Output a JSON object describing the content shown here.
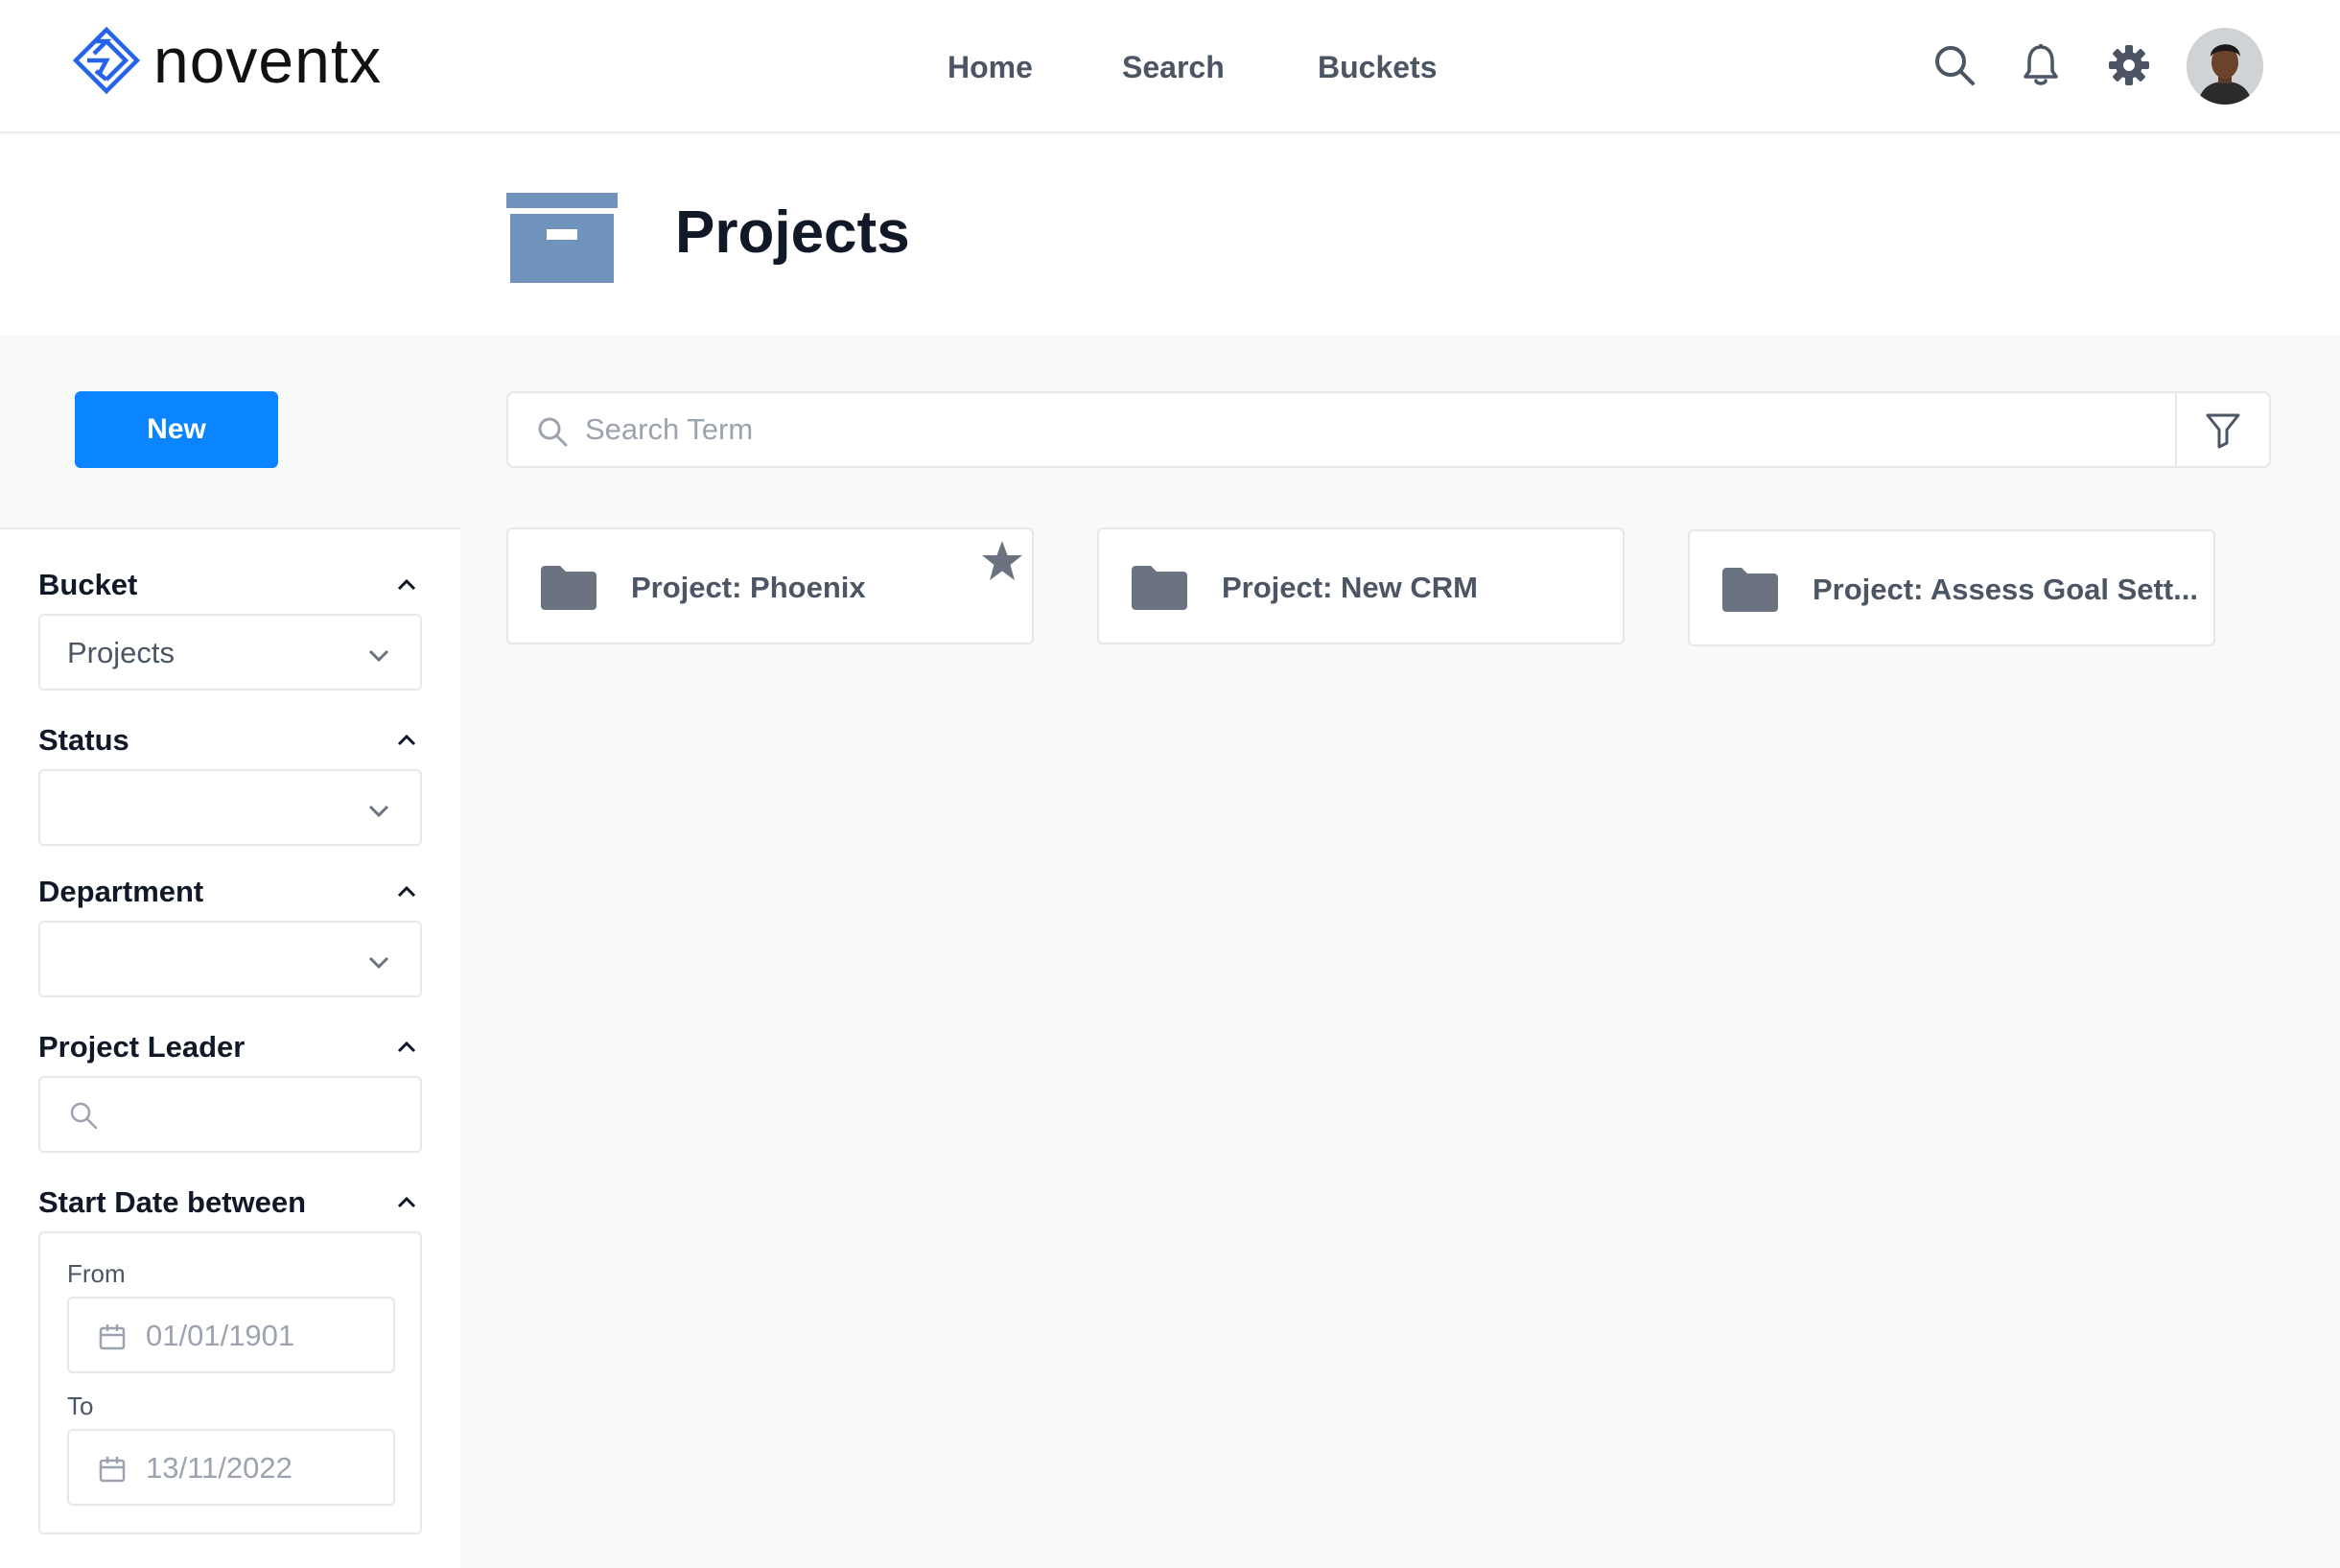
{
  "app": {
    "brand": "noventx"
  },
  "nav": {
    "home": "Home",
    "search": "Search",
    "buckets": "Buckets"
  },
  "icons": {
    "header": [
      "search-icon",
      "bell-icon",
      "gear-icon"
    ],
    "title": "archive-box-icon",
    "card": "folder-icon",
    "favorite": "star-icon",
    "filter": "funnel-icon"
  },
  "colors": {
    "primary": "#0a84ff",
    "brand_blue": "#2563eb",
    "box_icon": "#6f93bb",
    "folder": "#6b7280"
  },
  "page": {
    "title": "Projects"
  },
  "actions": {
    "new_label": "New",
    "search_placeholder": "Search Term"
  },
  "filters": {
    "bucket": {
      "label": "Bucket",
      "value": "Projects"
    },
    "status": {
      "label": "Status",
      "value": ""
    },
    "department": {
      "label": "Department",
      "value": ""
    },
    "leader": {
      "label": "Project Leader",
      "value": ""
    },
    "start_date": {
      "label": "Start Date between",
      "from_label": "From",
      "from_value": "01/01/1901",
      "to_label": "To",
      "to_value": "13/11/2022"
    }
  },
  "projects": [
    {
      "title": "Project: Phoenix",
      "favorite": true
    },
    {
      "title": "Project: New CRM",
      "favorite": false
    },
    {
      "title": "Project: Assess Goal Sett...",
      "favorite": false
    }
  ]
}
